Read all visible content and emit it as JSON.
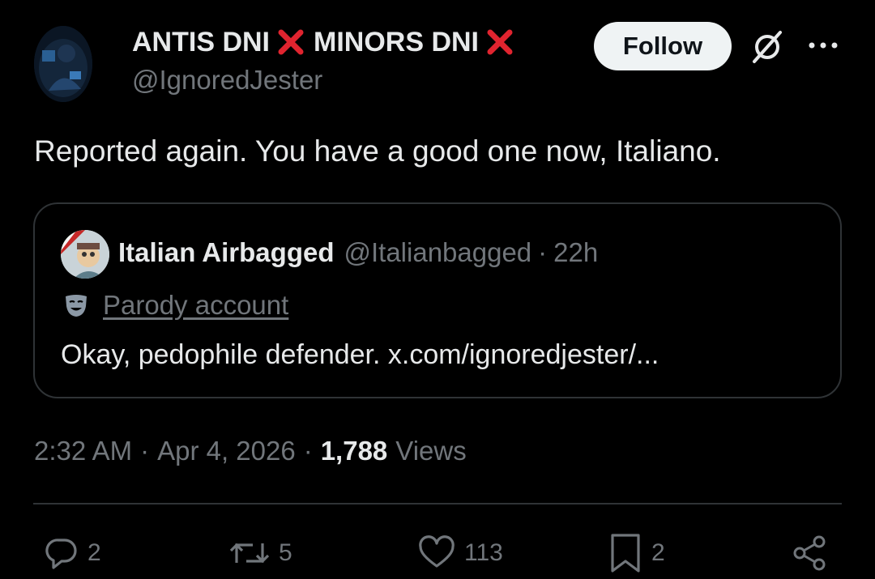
{
  "author": {
    "display_name_part1": "ANTIS DNI",
    "display_name_part2": "MINORS DNI",
    "handle": "@IgnoredJester"
  },
  "header": {
    "follow_label": "Follow"
  },
  "tweet": {
    "text": "Reported again. You have a good one now, Italiano."
  },
  "quote": {
    "name": "Italian Airbagged",
    "handle": "@Italianbagged",
    "separator": "·",
    "time": "22h",
    "parody_label": "Parody account",
    "text": "Okay, pedophile defender. x.com/ignoredjester/..."
  },
  "meta": {
    "time": "2:32 AM",
    "dot1": "·",
    "date": "Apr 4, 2026",
    "dot2": "·",
    "views_count": "1,788",
    "views_label": "Views"
  },
  "actions": {
    "replies": "2",
    "reposts": "5",
    "likes": "113",
    "bookmarks": "2"
  },
  "colors": {
    "background": "#000000",
    "text_primary": "#e7e9ea",
    "text_secondary": "#71767b",
    "border": "#2f3336",
    "cross_mark": "#e0242f",
    "follow_bg": "#eff3f4"
  },
  "icons": [
    "cross-mark-emoji-icon",
    "grok-icon",
    "more-icon",
    "mask-icon",
    "reply-icon",
    "repost-icon",
    "like-icon",
    "bookmark-icon",
    "share-icon"
  ]
}
